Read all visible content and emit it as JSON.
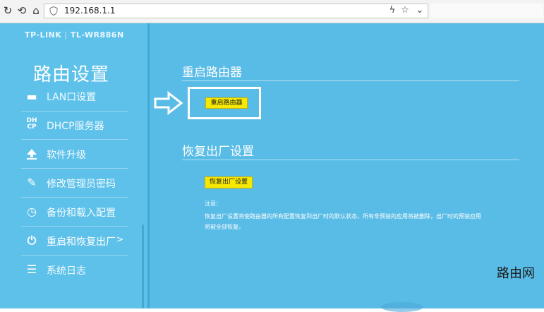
{
  "browser": {
    "url": "192.168.1.1",
    "icons": [
      "refresh-icon",
      "back-icon",
      "shield-icon",
      "lightning-icon",
      "star-icon",
      "chevron-down-icon"
    ]
  },
  "brand": {
    "name": "TP-LINK",
    "model": "TL-WR886N"
  },
  "sidebar": {
    "title": "路由设置",
    "items": [
      {
        "label": "LAN口设置",
        "icon": "lan-icon"
      },
      {
        "label": "DHCP服务器",
        "icon": "dhcp-icon"
      },
      {
        "label": "软件升级",
        "icon": "upload-icon"
      },
      {
        "label": "修改管理员密码",
        "icon": "pencil-icon"
      },
      {
        "label": "备份和载入配置",
        "icon": "history-icon"
      },
      {
        "label": "重启和恢复出厂",
        "icon": "power-icon",
        "active": true,
        "arrow": ">"
      },
      {
        "label": "系统日志",
        "icon": "list-icon"
      }
    ]
  },
  "main": {
    "reboot": {
      "title": "重启路由器",
      "button": "重启路由器"
    },
    "factory": {
      "title": "恢复出厂设置",
      "button": "恢复出厂设置"
    },
    "note": {
      "label": "注意：",
      "line1": "恢复出厂设置将使路由器的所有配置恢复到出厂时的默认状态，所有非预装的应用将被删除，出厂时的预装应用",
      "line2": "将被全部恢复。"
    }
  },
  "watermark": "路由网",
  "colors": {
    "background": "#59bce6",
    "sidebar": "#5ec1ea",
    "button": "#f6e800"
  }
}
